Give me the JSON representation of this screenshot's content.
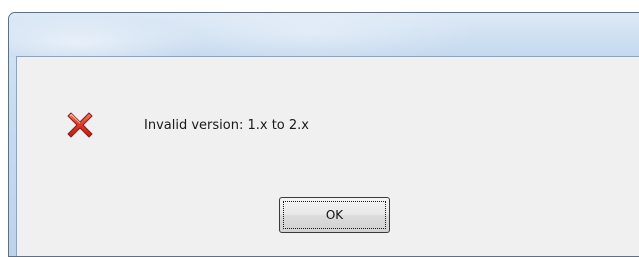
{
  "dialog": {
    "message": "Invalid version: 1.x to 2.x",
    "icon": "error-x-icon",
    "ok_label": "OK"
  },
  "colors": {
    "client_background": "#f0f0f0",
    "error_icon_red": "#d93a2b"
  }
}
